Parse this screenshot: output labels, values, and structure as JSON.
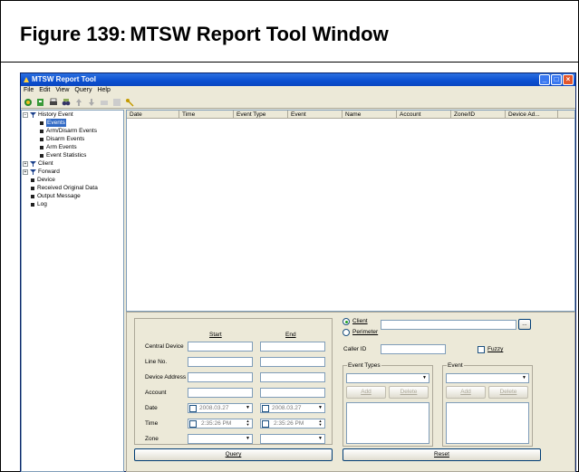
{
  "figure": {
    "label": "Figure 139:",
    "title": "MTSW Report Tool Window"
  },
  "window": {
    "title": "MTSW Report Tool"
  },
  "menu": [
    "File",
    "Edit",
    "View",
    "Query",
    "Help"
  ],
  "tree": {
    "history_event": "History Event",
    "events": "Events",
    "arm_disarm_events": "Arm/Disarm Events",
    "disarm_events": "Disarm Events",
    "arm_events": "Arm Events",
    "event_statistics": "Event Statistics",
    "client": "Client",
    "forward": "Forward",
    "device": "Device",
    "received_original_data": "Received Original Data",
    "output_message": "Output Message",
    "log": "Log"
  },
  "columns": [
    "Date",
    "Time",
    "Event Type",
    "Event",
    "Name",
    "Account",
    "Zone/ID",
    "Device Ad..."
  ],
  "query": {
    "start": "Start",
    "end": "End",
    "central_device": "Central Device",
    "line_no": "Line No.",
    "device_address": "Device Address",
    "account": "Account",
    "date": "Date",
    "time": "Time",
    "zone": "Zone",
    "date_start": "2008.03.27",
    "date_end": "2008.03.27",
    "time_start": "2:35:26 PM",
    "time_end": "2:35:26 PM",
    "client": "Client",
    "perimeter": "Perimeter",
    "browse": "...",
    "caller_id": "Caller ID",
    "fuzzy": "Fuzzy",
    "event_types": "Event Types",
    "event": "Event",
    "add": "Add",
    "delete": "Delete",
    "query_btn": "Query",
    "reset_btn": "Reset"
  }
}
